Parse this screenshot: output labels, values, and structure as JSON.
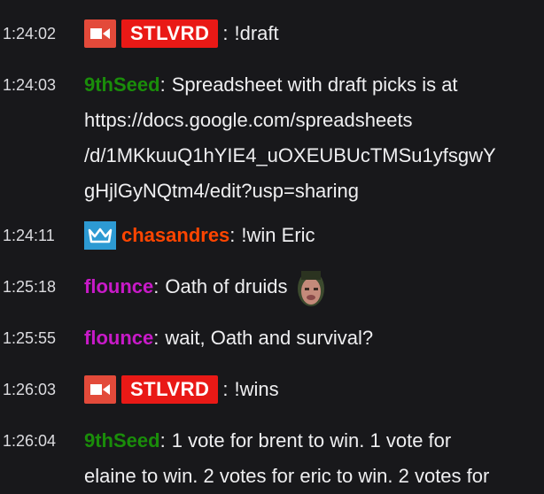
{
  "colors": {
    "background": "#18181b",
    "text": "#efeff1",
    "stlvrd_badge": "#e91916",
    "cam_badge": "#e34a3a",
    "crown_badge": "#2d9ad3",
    "user_9thseed": "#1a8d0a",
    "user_chasandres": "#ff4500",
    "user_flounce": "#c81ac8"
  },
  "messages": [
    {
      "time": "1:24:02",
      "badge_icon": "video-camera-icon",
      "user": "STLVRD",
      "sep": ":",
      "text": "!draft"
    },
    {
      "time": "1:24:03",
      "user": "9thSeed",
      "sep": ":",
      "lines": [
        "Spreadsheet with draft picks is at",
        "https://docs.google.com/spreadsheets",
        "/d/1MKkuuQ1hYIE4_uOXEUBUcTMSu1yfsgwY",
        "gHjlGyNQtm4/edit?usp=sharing"
      ]
    },
    {
      "time": "1:24:11",
      "badge_icon": "crown-icon",
      "user": "chasandres",
      "sep": ":",
      "text": "!win Eric"
    },
    {
      "time": "1:25:18",
      "user": "flounce",
      "sep": ":",
      "text": "Oath of druids",
      "emote_icon": "face-emote-icon"
    },
    {
      "time": "1:25:55",
      "user": "flounce",
      "sep": ":",
      "text": "wait, Oath and survival?"
    },
    {
      "time": "1:26:03",
      "badge_icon": "video-camera-icon",
      "user": "STLVRD",
      "sep": ":",
      "text": "!wins"
    },
    {
      "time": "1:26:04",
      "user": "9thSeed",
      "sep": ":",
      "lines": [
        "1 vote for brent to win. 1 vote for",
        "elaine to win. 2 votes for eric to win. 2 votes for"
      ]
    }
  ]
}
